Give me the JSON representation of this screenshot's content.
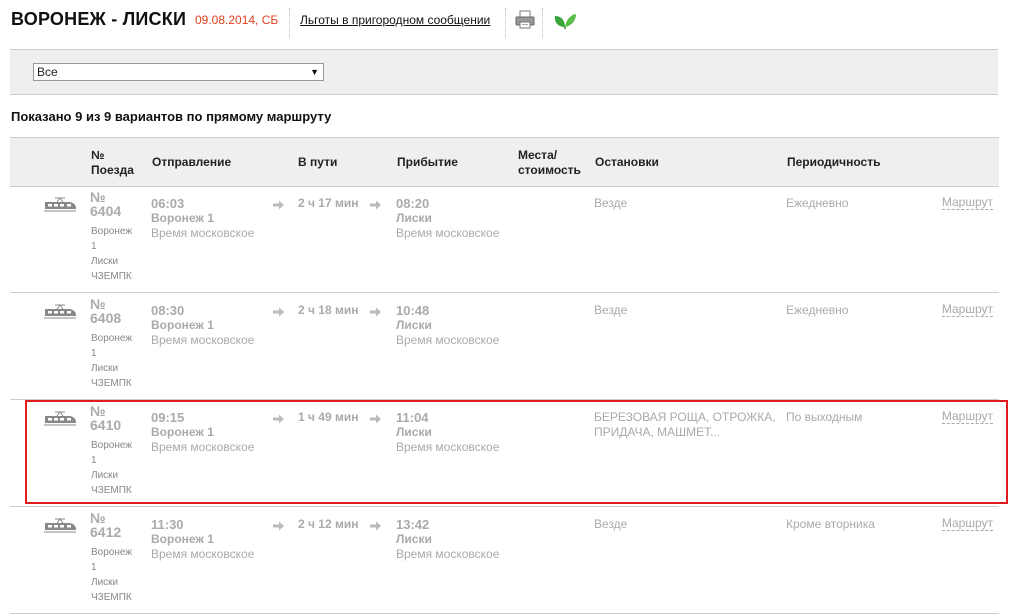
{
  "header": {
    "title": "ВОРОНЕЖ - ЛИСКИ",
    "date": "09.08.2014, СБ",
    "benefits_link": "Льготы в пригородном сообщении"
  },
  "filter": {
    "selected": "Все"
  },
  "summary": "Показано 9 из 9 вариантов по прямому маршруту",
  "columns": {
    "number": [
      "№",
      "Поезда"
    ],
    "departure": "Отправление",
    "duration": "В пути",
    "arrival": "Прибытие",
    "seats": [
      "Места/",
      "стоимость"
    ],
    "stops": "Остановки",
    "periodicity": "Периодичность"
  },
  "rows": [
    {
      "num_label": "№",
      "num": "6404",
      "desc": [
        "Воронеж",
        "1",
        "Лиски",
        "ЧЗЕМПК"
      ],
      "dep_time": "06:03",
      "dep_station": "Воронеж 1",
      "dep_tz": "Время московское",
      "duration": "2 ч 17 мин",
      "arr_time": "08:20",
      "arr_station": "Лиски",
      "arr_tz": "Время московское",
      "stops": [
        "Везде"
      ],
      "period": "Ежедневно",
      "route": "Маршрут"
    },
    {
      "num_label": "№",
      "num": "6408",
      "desc": [
        "Воронеж",
        "1",
        "Лиски",
        "ЧЗЕМПК"
      ],
      "dep_time": "08:30",
      "dep_station": "Воронеж 1",
      "dep_tz": "Время московское",
      "duration": "2 ч 18 мин",
      "arr_time": "10:48",
      "arr_station": "Лиски",
      "arr_tz": "Время московское",
      "stops": [
        "Везде"
      ],
      "period": "Ежедневно",
      "route": "Маршрут"
    },
    {
      "num_label": "№",
      "num": "6410",
      "desc": [
        "Воронеж",
        "1",
        "Лиски",
        "ЧЗЕМПК"
      ],
      "dep_time": "09:15",
      "dep_station": "Воронеж 1",
      "dep_tz": "Время московское",
      "duration": "1 ч 49 мин",
      "arr_time": "11:04",
      "arr_station": "Лиски",
      "arr_tz": "Время московское",
      "stops": [
        "БЕРЕЗОВАЯ РОЩА, ОТРОЖКА,",
        "ПРИДАЧА, МАШМЕТ..."
      ],
      "period": "По выходным",
      "route": "Маршрут"
    },
    {
      "num_label": "№",
      "num": "6412",
      "desc": [
        "Воронеж",
        "1",
        "Лиски",
        "ЧЗЕМПК"
      ],
      "dep_time": "11:30",
      "dep_station": "Воронеж 1",
      "dep_tz": "Время московское",
      "duration": "2 ч 12 мин",
      "arr_time": "13:42",
      "arr_station": "Лиски",
      "arr_tz": "Время московское",
      "stops": [
        "Везде"
      ],
      "period": "Кроме вторника",
      "route": "Маршрут"
    }
  ],
  "icons": {
    "print": "printer-icon",
    "eco": "leaf-icon",
    "train": "train-icon",
    "arrow": "arrow-right-icon",
    "select": "chevron-down-icon"
  },
  "colors": {
    "date": "#e0401c",
    "highlight": "#e01d1d",
    "muted": "#aaaaaa"
  }
}
